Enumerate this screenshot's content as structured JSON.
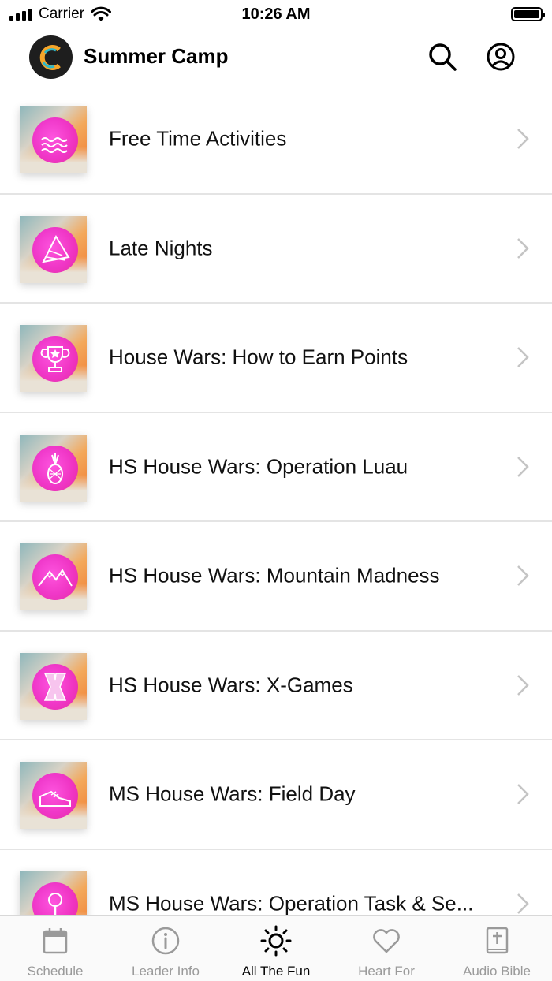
{
  "status_bar": {
    "carrier": "Carrier",
    "time": "10:26 AM"
  },
  "header": {
    "title": "Summer Camp",
    "search_icon": "search-icon",
    "account_icon": "account-circle-icon"
  },
  "items": [
    {
      "label": "Free Time Activities",
      "icon": "waves-icon"
    },
    {
      "label": "Late Nights",
      "icon": "party-hat-icon"
    },
    {
      "label": "House Wars: How to Earn Points",
      "icon": "trophy-icon"
    },
    {
      "label": "HS House Wars: Operation Luau",
      "icon": "pineapple-icon"
    },
    {
      "label": "HS House Wars: Mountain Madness",
      "icon": "mountain-icon"
    },
    {
      "label": "HS House Wars: X-Games",
      "icon": "x-letter-icon"
    },
    {
      "label": "MS House Wars: Field Day",
      "icon": "sneaker-icon"
    },
    {
      "label": "MS House Wars: Operation Task & Se...",
      "icon": "magnifier-icon"
    }
  ],
  "tabs": [
    {
      "label": "Schedule",
      "icon": "calendar-icon",
      "active": false
    },
    {
      "label": "Leader Info",
      "icon": "info-icon",
      "active": false
    },
    {
      "label": "All The Fun",
      "icon": "sun-icon",
      "active": true
    },
    {
      "label": "Heart For",
      "icon": "heart-icon",
      "active": false
    },
    {
      "label": "Audio Bible",
      "icon": "bible-icon",
      "active": false
    }
  ],
  "colors": {
    "accent_pink": "#f02fc9",
    "active_tab": "#000000",
    "inactive_tab": "#9a9a9a",
    "divider": "#e4e4e4"
  }
}
